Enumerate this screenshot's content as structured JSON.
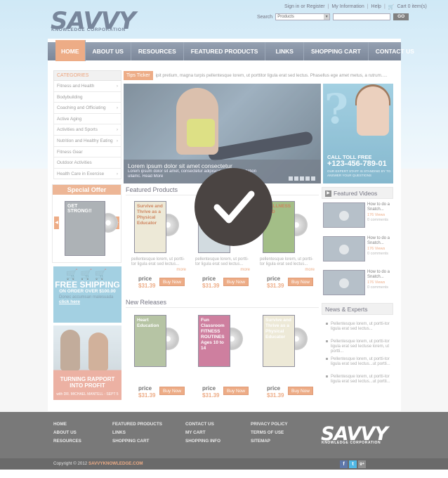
{
  "header": {
    "logo": "SAVVY",
    "logo_sub": "KNOWLEDGE CORPORATION",
    "links": [
      "Sign in or Register",
      "My Information",
      "Help",
      "Cart 0 item(s)"
    ],
    "search_label": "Search",
    "search_select": "Products",
    "go": "GO"
  },
  "nav": [
    "HOME",
    "ABOUT US",
    "RESOURCES",
    "FEATURED PRODUCTS",
    "LINKS",
    "SHOPPING CART",
    "CONTACT US"
  ],
  "categories": {
    "heading": "CATEGORIES",
    "items": [
      {
        "label": "Fitness and Health",
        "chevron": true
      },
      {
        "label": "Bodybuilding",
        "chevron": false
      },
      {
        "label": "Coaching and Officiating",
        "chevron": true
      },
      {
        "label": "Active Aging",
        "chevron": false
      },
      {
        "label": "Activities and Sports",
        "chevron": true
      },
      {
        "label": "Nutrition and Healthy Eating",
        "chevron": true
      },
      {
        "label": "Fitness Gear",
        "chevron": false
      },
      {
        "label": "Outdoor Activities",
        "chevron": false
      },
      {
        "label": "Health Care in Exercise",
        "chevron": true
      }
    ]
  },
  "special": {
    "heading": "Special Offer",
    "product": "GET STRONG!!"
  },
  "freeship": {
    "title": "FREE SHIPPING",
    "sub": "ON ORDER OVER $100.00",
    "desc": "Donec accumsan malesuada",
    "link": "click here"
  },
  "promo": {
    "title": "TURNING RAPPORT INTO PROFIT",
    "sub": "with DR. MICHAEL MANTELL - SEPT 5"
  },
  "ticker": {
    "label": "Tips Ticker",
    "text": "ipit pretium, magna turpis pellentesque lorem, ut porttitor ligula erat sed lectus. Phasellus ege amet metus, a rutrum....."
  },
  "hero": {
    "title": "Lorem ipsum dolor sit amet consectetur",
    "desc": "Lorem ipsum dolor sit amet, consectetur adipisicin",
    "desc2": "ullamc. Read More",
    "overlap": "modexercitation"
  },
  "callbox": {
    "line1": "CALL TOLL FREE",
    "phone": "+123-456-789-01",
    "note": "OUR EXPERT STAFF IS STANDING BY TO ANSWER YOUR QUESTIONS"
  },
  "featured": {
    "heading": "Featured Products",
    "items": [
      {
        "title": "Survive and Thrive as a Physical Educator",
        "desc": "pellentesque lorem, ut portti-tor ligula erat sed lectus...",
        "more": "more",
        "price_label": "price",
        "price": "$31.39",
        "buy": "Buy Now",
        "color": "#e9e4cf"
      },
      {
        "title": "",
        "desc": "pellentesque lorem, ut portti-tor ligula erat sed lectus...",
        "more": "more",
        "price_label": "price",
        "price": "$31.39",
        "buy": "Buy Now",
        "color": "#c9d4da"
      },
      {
        "title": "WELLNESS DVD",
        "desc": "pellentesque lorem, ut portti-tor ligula erat sed lectus...",
        "more": "more",
        "price_label": "price",
        "price": "$31.39",
        "buy": "Buy Now",
        "color": "#8fb06d"
      }
    ]
  },
  "releases": {
    "heading": "New Releases",
    "items": [
      {
        "title": "Heart Education",
        "price_label": "price",
        "price": "$31.39",
        "buy": "Buy Now",
        "color": "#a6b890"
      },
      {
        "title": "Fun Classroom FITNESS ROUTINES Ages 10 to 14",
        "price_label": "price",
        "price": "$31.39",
        "buy": "Buy Now",
        "color": "#c4638a"
      },
      {
        "title": "Survive and Thrive as a Physical Educator",
        "price_label": "price",
        "price": "$31.39",
        "buy": "Buy Now",
        "color": "#e9e4cf"
      }
    ]
  },
  "videos": {
    "heading": "Featured Videos",
    "items": [
      {
        "title": "How to do a Snatch...",
        "views": "176 Views",
        "comments": "0 comments"
      },
      {
        "title": "How to do a Snatch...",
        "views": "176 Views",
        "comments": "0 comments"
      },
      {
        "title": "How to do a Snatch...",
        "views": "176 Views",
        "comments": "0 comments"
      }
    ]
  },
  "news": {
    "heading": "News & Experts",
    "items": [
      "Pellentesque lorem, ut portti-tor ligula erat sed lectus...",
      "Pellentesque lorem, ut portti-tor ligula erat sed lectuse lorem, ut portti...",
      "Pellentesque lorem, ut portti-tor ligula erat sed lectus...ut portti...",
      "Pellentesque lorem, ut portti-tor ligula erat sed lectus...ut portti..."
    ]
  },
  "footer": {
    "col1": [
      "HOME",
      "ABOUT US",
      "RESOURCES"
    ],
    "col2": [
      "FEATURED PRODUCTS",
      "LINKS",
      "SHOPPING CART"
    ],
    "col3": [
      "CONTACT US",
      "MY CART",
      "SHOPPING INFO"
    ],
    "col4": [
      "PRIVACY POLICY",
      "TERMS OF USE",
      "SITEMAP"
    ],
    "logo": "SAVVY",
    "logo_sub": "KNOWLEDGE CORPORATION",
    "copyright": "Copyright © 2012",
    "copyright_site": "SAVVYKNOWLEDGE.COM",
    "social": [
      "f",
      "t",
      "g+"
    ]
  },
  "colors": {
    "accent": "#e99a6c",
    "nav": "#6e7c92",
    "checkmark_bg": "#4a4442",
    "footer": "#5c5c5c"
  }
}
